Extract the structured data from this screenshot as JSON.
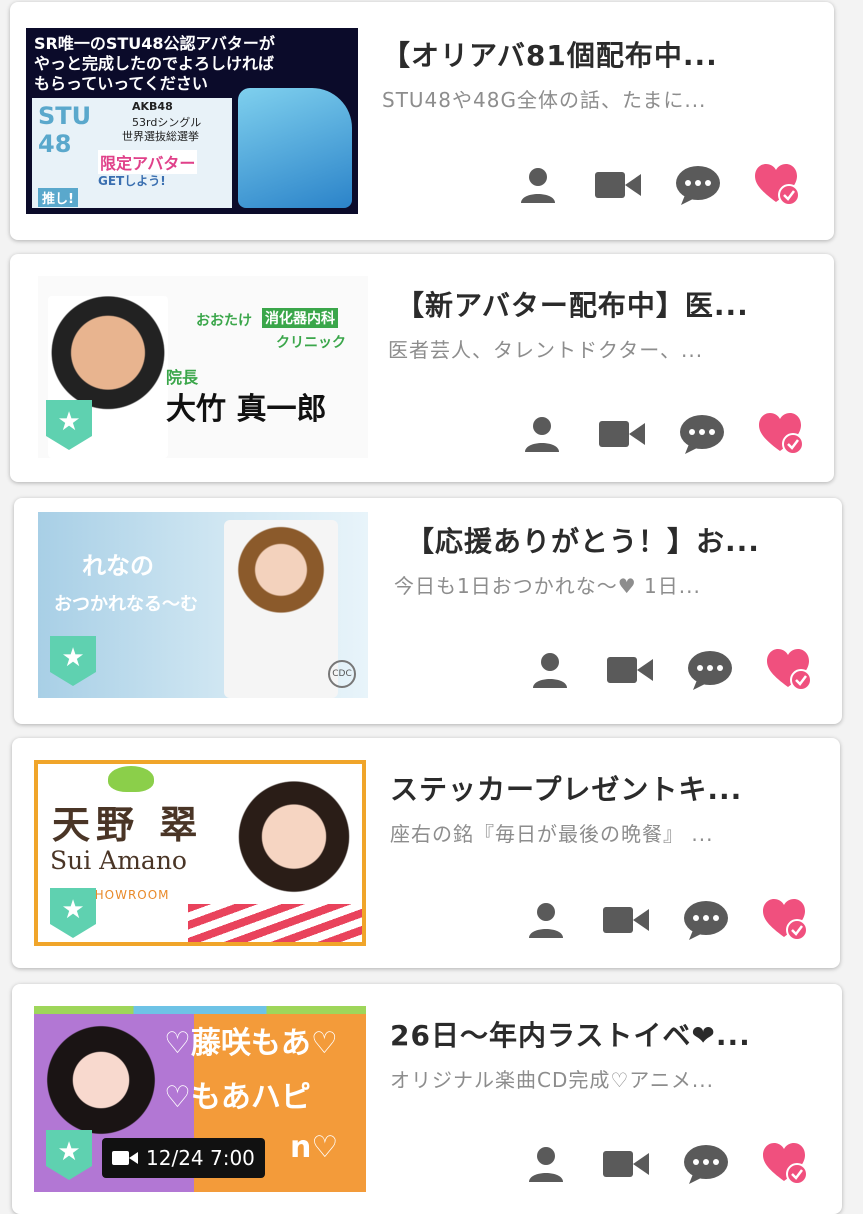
{
  "rooms": [
    {
      "title": "【オリアバ81個配布中...",
      "subtitle": "STU48や48G全体の話、たまに...",
      "thumb_text": [
        "SR唯一のSTU48公認アバターが",
        "やっと完成したのでよろしければ",
        "もらっていってください"
      ],
      "thumb_sub": [
        "STU",
        "48",
        "AKB48",
        "53rdシングル",
        "世界選抜総選挙",
        "限定アバター",
        "GETしよう!",
        "推し!"
      ],
      "has_official_badge": false
    },
    {
      "title": "【新アバター配布中】医...",
      "subtitle": "医者芸人、タレントドクター、...",
      "thumb_text": [
        "おおたけ",
        "消化器内科",
        "クリニック",
        "院長",
        "大竹 真一郎"
      ],
      "has_official_badge": true
    },
    {
      "title": "【応援ありがとう！】お...",
      "subtitle": "今日も1日おつかれな〜♥ 1日...",
      "thumb_text": [
        "れなの",
        "おつかれなる〜む",
        "CDC"
      ],
      "has_official_badge": true
    },
    {
      "title": "ステッカープレゼントキ...",
      "subtitle": "座右の銘『毎日が最後の晩餐』 ...",
      "thumb_text": [
        "天野 翠",
        "Sui Amano",
        "SHOWROOM"
      ],
      "has_official_badge": true
    },
    {
      "title": "26日〜年内ラストイベ❤...",
      "subtitle": "オリジナル楽曲CD完成♡アニメ...",
      "thumb_text": [
        "♡藤咲もあ♡",
        "♡もあハピ",
        "n♡"
      ],
      "has_official_badge": true,
      "live_time": "12/24 7:00"
    }
  ],
  "icons": {
    "profile": "person-icon",
    "video": "video-camera-icon",
    "comment": "comment-bubble-icon",
    "follow": "heart-check-icon"
  },
  "colors": {
    "icon_gray": "#5a5a5a",
    "heart_pink": "#f0507e",
    "badge_green": "#5fd1b0"
  }
}
